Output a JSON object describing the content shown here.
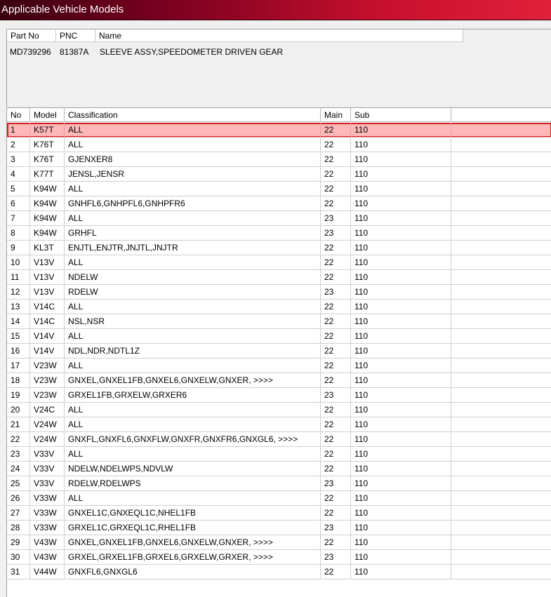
{
  "window": {
    "title": "Applicable Vehicle Models"
  },
  "parts": {
    "columns": [
      "Part No",
      "PNC",
      "Name"
    ],
    "row": {
      "part_no": "MD739296",
      "pnc": "81387A",
      "name": "SLEEVE ASSY,SPEEDOMETER DRIVEN GEAR"
    }
  },
  "models_table": {
    "columns": [
      "No",
      "Model",
      "Classification",
      "Main",
      "Sub"
    ],
    "selected_row": 1,
    "rows": [
      {
        "no": "1",
        "model": "K57T",
        "classification": "ALL",
        "main": "22",
        "sub": "110"
      },
      {
        "no": "2",
        "model": "K76T",
        "classification": "ALL",
        "main": "22",
        "sub": "110"
      },
      {
        "no": "3",
        "model": "K76T",
        "classification": "GJENXER8",
        "main": "22",
        "sub": "110"
      },
      {
        "no": "4",
        "model": "K77T",
        "classification": "JENSL,JENSR",
        "main": "22",
        "sub": "110"
      },
      {
        "no": "5",
        "model": "K94W",
        "classification": "ALL",
        "main": "22",
        "sub": "110"
      },
      {
        "no": "6",
        "model": "K94W",
        "classification": "GNHFL6,GNHPFL6,GNHPFR6",
        "main": "22",
        "sub": "110"
      },
      {
        "no": "7",
        "model": "K94W",
        "classification": "ALL",
        "main": "23",
        "sub": "110"
      },
      {
        "no": "8",
        "model": "K94W",
        "classification": "GRHFL",
        "main": "23",
        "sub": "110"
      },
      {
        "no": "9",
        "model": "KL3T",
        "classification": "ENJTL,ENJTR,JNJTL,JNJTR",
        "main": "22",
        "sub": "110"
      },
      {
        "no": "10",
        "model": "V13V",
        "classification": "ALL",
        "main": "22",
        "sub": "110"
      },
      {
        "no": "11",
        "model": "V13V",
        "classification": "NDELW",
        "main": "22",
        "sub": "110"
      },
      {
        "no": "12",
        "model": "V13V",
        "classification": "RDELW",
        "main": "23",
        "sub": "110"
      },
      {
        "no": "13",
        "model": "V14C",
        "classification": "ALL",
        "main": "22",
        "sub": "110"
      },
      {
        "no": "14",
        "model": "V14C",
        "classification": "NSL,NSR",
        "main": "22",
        "sub": "110"
      },
      {
        "no": "15",
        "model": "V14V",
        "classification": "ALL",
        "main": "22",
        "sub": "110"
      },
      {
        "no": "16",
        "model": "V14V",
        "classification": "NDL,NDR,NDTL1Z",
        "main": "22",
        "sub": "110"
      },
      {
        "no": "17",
        "model": "V23W",
        "classification": "ALL",
        "main": "22",
        "sub": "110"
      },
      {
        "no": "18",
        "model": "V23W",
        "classification": "GNXEL,GNXEL1FB,GNXEL6,GNXELW,GNXER,  >>>>",
        "main": "22",
        "sub": "110"
      },
      {
        "no": "19",
        "model": "V23W",
        "classification": "GRXEL1FB,GRXELW,GRXER6",
        "main": "23",
        "sub": "110"
      },
      {
        "no": "20",
        "model": "V24C",
        "classification": "ALL",
        "main": "22",
        "sub": "110"
      },
      {
        "no": "21",
        "model": "V24W",
        "classification": "ALL",
        "main": "22",
        "sub": "110"
      },
      {
        "no": "22",
        "model": "V24W",
        "classification": "GNXFL,GNXFL6,GNXFLW,GNXFR,GNXFR6,GNXGL6,  >>>>",
        "main": "22",
        "sub": "110"
      },
      {
        "no": "23",
        "model": "V33V",
        "classification": "ALL",
        "main": "22",
        "sub": "110"
      },
      {
        "no": "24",
        "model": "V33V",
        "classification": "NDELW,NDELWPS,NDVLW",
        "main": "22",
        "sub": "110"
      },
      {
        "no": "25",
        "model": "V33V",
        "classification": "RDELW,RDELWPS",
        "main": "23",
        "sub": "110"
      },
      {
        "no": "26",
        "model": "V33W",
        "classification": "ALL",
        "main": "22",
        "sub": "110"
      },
      {
        "no": "27",
        "model": "V33W",
        "classification": "GNXEL1C,GNXEQL1C,NHEL1FB",
        "main": "22",
        "sub": "110"
      },
      {
        "no": "28",
        "model": "V33W",
        "classification": "GRXEL1C,GRXEQL1C,RHEL1FB",
        "main": "23",
        "sub": "110"
      },
      {
        "no": "29",
        "model": "V43W",
        "classification": "GNXEL,GNXEL1FB,GNXEL6,GNXELW,GNXER,  >>>>",
        "main": "22",
        "sub": "110"
      },
      {
        "no": "30",
        "model": "V43W",
        "classification": "GRXEL,GRXEL1FB,GRXEL6,GRXELW,GRXER,  >>>>",
        "main": "23",
        "sub": "110"
      },
      {
        "no": "31",
        "model": "V44W",
        "classification": "GNXFL6,GNXGL6",
        "main": "22",
        "sub": "110"
      }
    ]
  },
  "colors": {
    "title_bar_start": "#3a0010",
    "title_bar_end": "#e0203a",
    "selection_fill": "#ffb8b8",
    "selection_border": "#d02020"
  }
}
